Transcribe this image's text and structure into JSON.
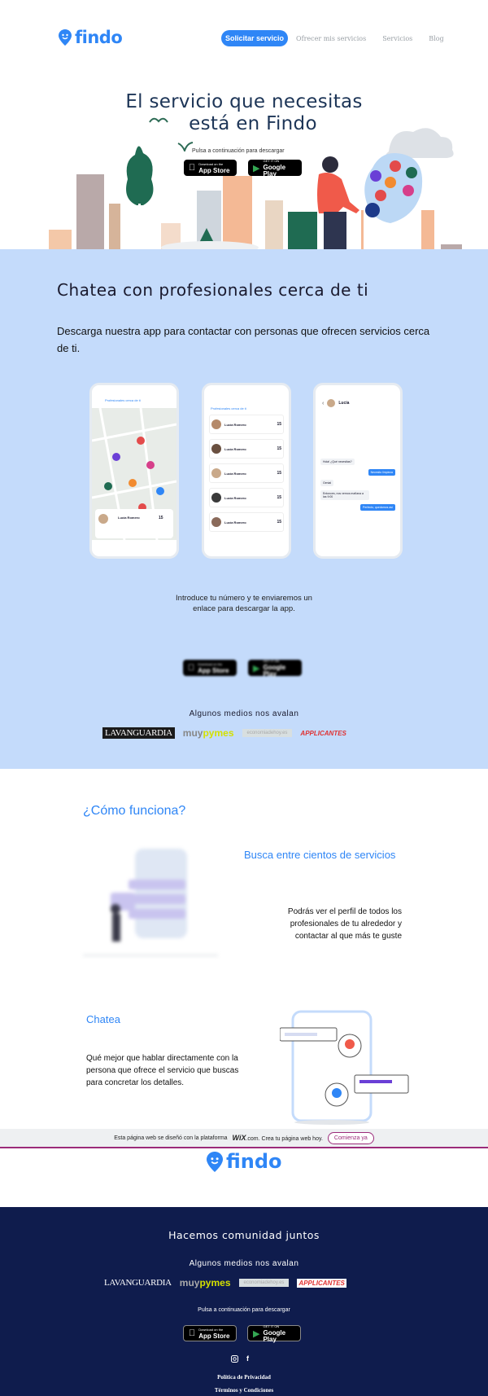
{
  "brand": {
    "name": "findo",
    "color": "#2f86f6"
  },
  "nav": {
    "active": "Solicitar servicio",
    "items": [
      "Ofrecer mis servicios",
      "Servicios",
      "Blog"
    ]
  },
  "hero": {
    "title_line1": "El servicio que necesitas",
    "title_line2": "está en Findo",
    "download_hint": "Pulsa a continuación para descargar"
  },
  "stores": {
    "appstore_small": "Download on the",
    "appstore_big": "App Store",
    "google_small": "GET IT ON",
    "google_big": "Google Play"
  },
  "chat_section": {
    "title": "Chatea con profesionales cerca de ti",
    "description": "Descarga nuestra app para contactar con personas que ofrecen servicios cerca de ti.",
    "intro_line1": "Introduce tu número y te enviaremos un",
    "intro_line2": "enlace para descargar la app.",
    "background": "#c4dbfb"
  },
  "phones": {
    "header_text": "Profesionales cerca de ti",
    "list_title": "Profesionales cerca de ti",
    "person_name": "Lucía Romero",
    "price": "15",
    "chat_name": "Lucía",
    "messages_left": [
      "Hola! ¿Qué necesitas?",
      "Genial",
      "Entonces, nos vemos mañana a las 9:00"
    ],
    "messages_right": [
      "Necesito limpieza",
      "Perfecto, quedamos así"
    ]
  },
  "press": {
    "heading": "Algunos medios nos avalan",
    "logos": [
      "LAVANGUARDIA",
      "muy",
      "pymes",
      "economiadehoy.es",
      "APPLICANTES"
    ]
  },
  "como_funciona": {
    "title": "¿Cómo funciona?",
    "step1_title": "Busca entre cientos de servicios",
    "step1_desc": "Podrás ver el perfil de todos los profesionales de tu alrededor y contactar al que más te guste",
    "step2_title": "Chatea",
    "step2_desc": "Qué mejor que hablar directamente con la persona que ofrece el servicio que buscas para concretar los detalles."
  },
  "wix_bar": {
    "text_before": "Esta página web se diseñó con la plataforma",
    "wix": "WiX",
    "text_after": ".com. Crea tu página web hoy.",
    "button": "Comienza ya"
  },
  "footer": {
    "title": "Hacemos comunidad juntos",
    "press_heading": "Algunos medios nos avalan",
    "download_hint": "Pulsa a continuación para descargar",
    "privacy": "Política de Privacidad",
    "terms": "Términos y Condiciones",
    "social": [
      "instagram-icon",
      "facebook-icon"
    ]
  }
}
